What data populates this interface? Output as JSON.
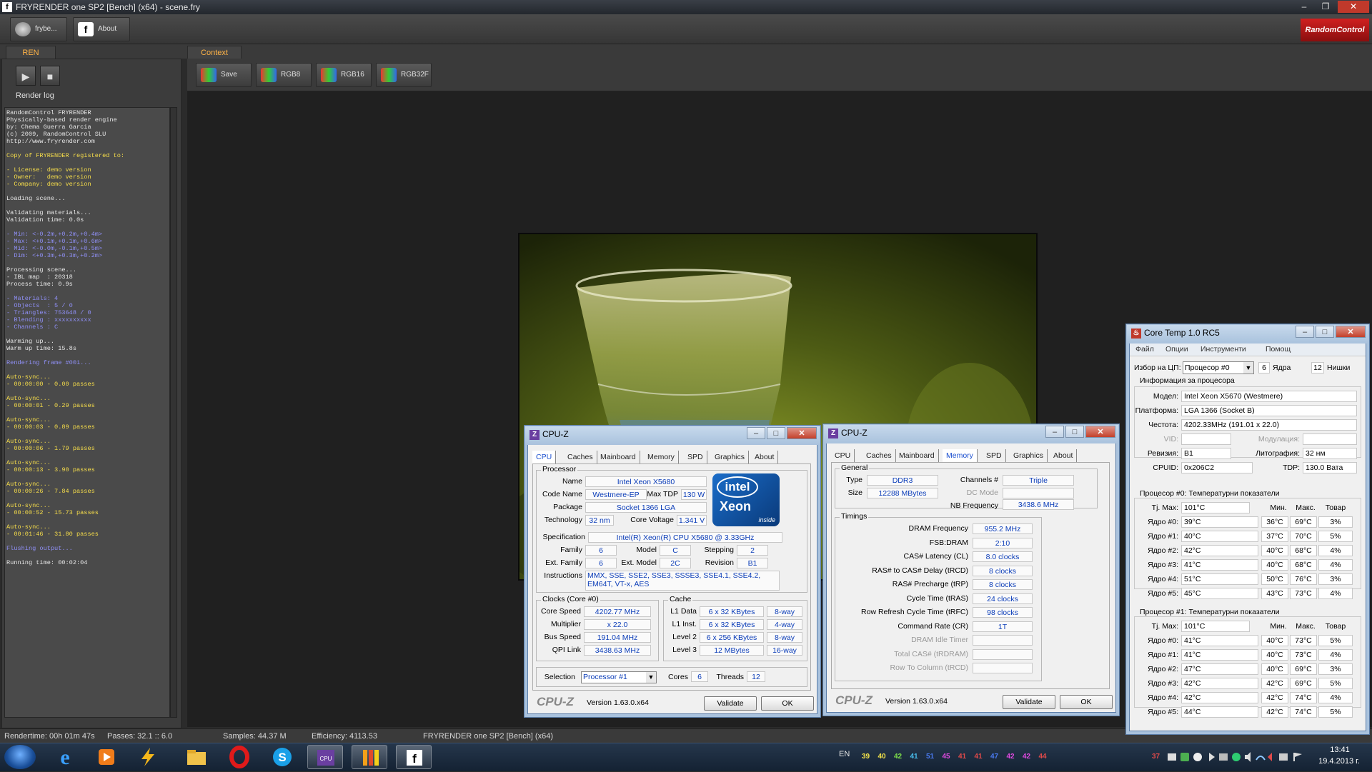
{
  "window": {
    "title": "FRYRENDER one SP2 [Bench] (x64) - scene.fry"
  },
  "toolbar": {
    "fry_label": "frybe...",
    "about_label": "About",
    "brand": "RandomControl"
  },
  "tabs": {
    "ren": "REN",
    "context": "Context"
  },
  "context_toolbar": {
    "save": "Save",
    "rgb8": "RGB8",
    "rgb16": "RGB16",
    "rgb32f": "RGB32F"
  },
  "render_log": {
    "title": "Render log",
    "lines": [
      {
        "t": "RandomControl FRYRENDER",
        "c": "w"
      },
      {
        "t": "Physically-based render engine",
        "c": "w"
      },
      {
        "t": "by: Chema Guerra Garcia",
        "c": "w"
      },
      {
        "t": "(c) 2009, RandomControl SLU",
        "c": "w"
      },
      {
        "t": "http://www.fryrender.com",
        "c": "w"
      },
      {
        "t": "",
        "c": "w"
      },
      {
        "t": "Copy of FRYRENDER registered to:",
        "c": "y"
      },
      {
        "t": "",
        "c": "w"
      },
      {
        "t": "- License: demo version",
        "c": "y"
      },
      {
        "t": "- Owner:   demo version",
        "c": "y"
      },
      {
        "t": "- Company: demo version",
        "c": "y"
      },
      {
        "t": "",
        "c": "w"
      },
      {
        "t": "Loading scene...",
        "c": "w"
      },
      {
        "t": "",
        "c": "w"
      },
      {
        "t": "Validating materials...",
        "c": "w"
      },
      {
        "t": "Validation time: 0.0s",
        "c": "w"
      },
      {
        "t": "",
        "c": "w"
      },
      {
        "t": "- Min: <-0.2m,+0.2m,+0.4m>",
        "c": "b"
      },
      {
        "t": "- Max: <+0.1m,+0.1m,+0.6m>",
        "c": "b"
      },
      {
        "t": "- Mid: <-0.0m,-0.1m,+0.5m>",
        "c": "b"
      },
      {
        "t": "- Dim: <+0.3m,+0.3m,+0.2m>",
        "c": "b"
      },
      {
        "t": "",
        "c": "w"
      },
      {
        "t": "Processing scene...",
        "c": "w"
      },
      {
        "t": "- IBL map  : 20318",
        "c": "w"
      },
      {
        "t": "Process time: 0.9s",
        "c": "w"
      },
      {
        "t": "",
        "c": "w"
      },
      {
        "t": "- Materials: 4",
        "c": "b"
      },
      {
        "t": "- Objects  : 5 / 0",
        "c": "b"
      },
      {
        "t": "- Triangles: 753648 / 0",
        "c": "b"
      },
      {
        "t": "- Blending : xxxxxxxxxx",
        "c": "b"
      },
      {
        "t": "- Channels : C",
        "c": "b"
      },
      {
        "t": "",
        "c": "w"
      },
      {
        "t": "Warming up...",
        "c": "w"
      },
      {
        "t": "Warm up time: 15.8s",
        "c": "w"
      },
      {
        "t": "",
        "c": "w"
      },
      {
        "t": "Rendering frame #001...",
        "c": "b"
      },
      {
        "t": "",
        "c": "w"
      },
      {
        "t": "Auto-sync...",
        "c": "y"
      },
      {
        "t": "- 00:00:00 - 0.00 passes",
        "c": "y"
      },
      {
        "t": "",
        "c": "w"
      },
      {
        "t": "Auto-sync...",
        "c": "y"
      },
      {
        "t": "- 00:00:01 - 0.29 passes",
        "c": "y"
      },
      {
        "t": "",
        "c": "w"
      },
      {
        "t": "Auto-sync...",
        "c": "y"
      },
      {
        "t": "- 00:00:03 - 0.89 passes",
        "c": "y"
      },
      {
        "t": "",
        "c": "w"
      },
      {
        "t": "Auto-sync...",
        "c": "y"
      },
      {
        "t": "- 00:00:06 - 1.79 passes",
        "c": "y"
      },
      {
        "t": "",
        "c": "w"
      },
      {
        "t": "Auto-sync...",
        "c": "y"
      },
      {
        "t": "- 00:00:13 - 3.90 passes",
        "c": "y"
      },
      {
        "t": "",
        "c": "w"
      },
      {
        "t": "Auto-sync...",
        "c": "y"
      },
      {
        "t": "- 00:00:26 - 7.84 passes",
        "c": "y"
      },
      {
        "t": "",
        "c": "w"
      },
      {
        "t": "Auto-sync...",
        "c": "y"
      },
      {
        "t": "- 00:00:52 - 15.73 passes",
        "c": "y"
      },
      {
        "t": "",
        "c": "w"
      },
      {
        "t": "Auto-sync...",
        "c": "y"
      },
      {
        "t": "- 00:01:46 - 31.80 passes",
        "c": "y"
      },
      {
        "t": "",
        "c": "w"
      },
      {
        "t": "Flushing output...",
        "c": "b"
      },
      {
        "t": "",
        "c": "w"
      },
      {
        "t": "Running time: 00:02:04",
        "c": "w"
      }
    ]
  },
  "statusbar": {
    "rendertime": "Rendertime:  00h 01m 47s",
    "passes": "Passes:  32.1 :: 6.0",
    "samples": "Samples:  44.37 M",
    "efficiency": "Efficiency:  4113.53",
    "app": "FRYRENDER one SP2 [Bench] (x64)"
  },
  "cpuz1": {
    "title": "CPU-Z",
    "tabs": [
      "CPU",
      "Caches",
      "Mainboard",
      "Memory",
      "SPD",
      "Graphics",
      "About"
    ],
    "active_tab": "CPU",
    "processor_group": "Processor",
    "labels": {
      "name": "Name",
      "code_name": "Code Name",
      "max_tdp": "Max TDP",
      "package": "Package",
      "technology": "Technology",
      "core_voltage": "Core Voltage",
      "specification": "Specification",
      "family": "Family",
      "model": "Model",
      "stepping": "Stepping",
      "ext_family": "Ext. Family",
      "ext_model": "Ext. Model",
      "revision": "Revision",
      "instructions": "Instructions"
    },
    "values": {
      "name": "Intel Xeon X5680",
      "code_name": "Westmere-EP",
      "max_tdp": "130 W",
      "package": "Socket 1366 LGA",
      "technology": "32 nm",
      "core_voltage": "1.341 V",
      "specification": "Intel(R) Xeon(R) CPU          X5680  @ 3.33GHz",
      "family": "6",
      "model": "C",
      "stepping": "2",
      "ext_family": "6",
      "ext_model": "2C",
      "revision": "B1",
      "instructions": "MMX, SSE, SSE2, SSE3, SSSE3, SSE4.1, SSE4.2, EM64T, VT-x, AES"
    },
    "logo": {
      "brand": "intel",
      "product": "Xeon",
      "tag": "inside"
    },
    "clocks": {
      "group": "Clocks (Core #0)",
      "core_speed_l": "Core Speed",
      "core_speed": "4202.77 MHz",
      "multiplier_l": "Multiplier",
      "multiplier": "x 22.0",
      "bus_speed_l": "Bus Speed",
      "bus_speed": "191.04 MHz",
      "qpi_l": "QPI Link",
      "qpi": "3438.63 MHz"
    },
    "cache": {
      "group": "Cache",
      "l1d_l": "L1 Data",
      "l1d": "6 x 32 KBytes",
      "l1d_w": "8-way",
      "l1i_l": "L1 Inst.",
      "l1i": "6 x 32 KBytes",
      "l1i_w": "4-way",
      "l2_l": "Level 2",
      "l2": "6 x 256 KBytes",
      "l2_w": "8-way",
      "l3_l": "Level 3",
      "l3": "12 MBytes",
      "l3_w": "16-way"
    },
    "selection_l": "Selection",
    "selection": "Processor #1",
    "cores_l": "Cores",
    "cores": "6",
    "threads_l": "Threads",
    "threads": "12",
    "footer": {
      "logo": "CPU-Z",
      "version": "Version 1.63.0.x64",
      "validate": "Validate",
      "ok": "OK"
    }
  },
  "cpuz2": {
    "title": "CPU-Z",
    "tabs": [
      "CPU",
      "Caches",
      "Mainboard",
      "Memory",
      "SPD",
      "Graphics",
      "About"
    ],
    "active_tab": "Memory",
    "general": {
      "group": "General",
      "type_l": "Type",
      "type": "DDR3",
      "channels_l": "Channels #",
      "channels": "Triple",
      "size_l": "Size",
      "size": "12288 MBytes",
      "dcmode_l": "DC Mode",
      "dcmode": "",
      "nbfreq_l": "NB Frequency",
      "nbfreq": "3438.6 MHz"
    },
    "timings": {
      "group": "Timings",
      "rows": [
        {
          "label": "DRAM Frequency",
          "value": "955.2 MHz",
          "dim": false
        },
        {
          "label": "FSB:DRAM",
          "value": "2:10",
          "dim": false
        },
        {
          "label": "CAS# Latency (CL)",
          "value": "8.0 clocks",
          "dim": false
        },
        {
          "label": "RAS# to CAS# Delay (tRCD)",
          "value": "8 clocks",
          "dim": false
        },
        {
          "label": "RAS# Precharge (tRP)",
          "value": "8 clocks",
          "dim": false
        },
        {
          "label": "Cycle Time (tRAS)",
          "value": "24 clocks",
          "dim": false
        },
        {
          "label": "Row Refresh Cycle Time (tRFC)",
          "value": "98 clocks",
          "dim": false
        },
        {
          "label": "Command Rate (CR)",
          "value": "1T",
          "dim": false
        },
        {
          "label": "DRAM Idle Timer",
          "value": "",
          "dim": true
        },
        {
          "label": "Total CAS# (tRDRAM)",
          "value": "",
          "dim": true
        },
        {
          "label": "Row To Column (tRCD)",
          "value": "",
          "dim": true
        }
      ]
    },
    "footer": {
      "logo": "CPU-Z",
      "version": "Version 1.63.0.x64",
      "validate": "Validate",
      "ok": "OK"
    }
  },
  "coretemp": {
    "title": "Core Temp 1.0 RC5",
    "menu": [
      "Файл",
      "Опции",
      "Инструменти",
      "Помощ"
    ],
    "cpu_select_l": "Избор на ЦП:",
    "cpu_select": "Процесор #0",
    "cores_n": "6",
    "cores_l": "Ядра",
    "threads_n": "12",
    "threads_l": "Нишки",
    "info_header": "Информация за процесора",
    "model_l": "Модел:",
    "model": "Intel Xeon X5670 (Westmere)",
    "platform_l": "Платформа:",
    "platform": "LGA 1366 (Socket B)",
    "freq_l": "Честота:",
    "freq": "4202.33MHz (191.01 x 22.0)",
    "vid_l": "VID:",
    "vid": "",
    "mod_l": "Модулация:",
    "mod": "",
    "rev_l": "Ревизия:",
    "rev": "B1",
    "litho_l": "Литография:",
    "litho": "32 нм",
    "cpuid_l": "CPUID:",
    "cpuid": "0x206C2",
    "tdp_l": "TDP:",
    "tdp": "130.0 Вата",
    "cpu0": {
      "header": "Процесор #0: Температурни показатели",
      "tjmax_l": "Tj. Max:",
      "tjmax": "101°C",
      "col_min": "Мин.",
      "col_max": "Макс.",
      "col_load": "Товар",
      "rows": [
        {
          "l": "Ядро #0:",
          "t": "39°C",
          "min": "36°C",
          "max": "69°C",
          "load": "3%"
        },
        {
          "l": "Ядро #1:",
          "t": "40°C",
          "min": "37°C",
          "max": "70°C",
          "load": "5%"
        },
        {
          "l": "Ядро #2:",
          "t": "42°C",
          "min": "40°C",
          "max": "68°C",
          "load": "4%"
        },
        {
          "l": "Ядро #3:",
          "t": "41°C",
          "min": "40°C",
          "max": "68°C",
          "load": "4%"
        },
        {
          "l": "Ядро #4:",
          "t": "51°C",
          "min": "50°C",
          "max": "76°C",
          "load": "3%"
        },
        {
          "l": "Ядро #5:",
          "t": "45°C",
          "min": "43°C",
          "max": "73°C",
          "load": "4%"
        }
      ]
    },
    "cpu1": {
      "header": "Процесор #1: Температурни показатели",
      "tjmax_l": "Tj. Max:",
      "tjmax": "101°C",
      "col_min": "Мин.",
      "col_max": "Макс.",
      "col_load": "Товар",
      "rows": [
        {
          "l": "Ядро #0:",
          "t": "41°C",
          "min": "40°C",
          "max": "73°C",
          "load": "5%"
        },
        {
          "l": "Ядро #1:",
          "t": "41°C",
          "min": "40°C",
          "max": "73°C",
          "load": "4%"
        },
        {
          "l": "Ядро #2:",
          "t": "47°C",
          "min": "40°C",
          "max": "69°C",
          "load": "3%"
        },
        {
          "l": "Ядро #3:",
          "t": "42°C",
          "min": "42°C",
          "max": "69°C",
          "load": "5%"
        },
        {
          "l": "Ядро #4:",
          "t": "42°C",
          "min": "42°C",
          "max": "74°C",
          "load": "4%"
        },
        {
          "l": "Ядро #5:",
          "t": "44°C",
          "min": "42°C",
          "max": "74°C",
          "load": "5%"
        }
      ]
    }
  },
  "taskbar": {
    "lang": "EN",
    "tray_temps": [
      {
        "v": "39",
        "color": "#f2e24a"
      },
      {
        "v": "40",
        "color": "#f2e24a"
      },
      {
        "v": "42",
        "color": "#7ee04a"
      },
      {
        "v": "41",
        "color": "#4ac0f0"
      },
      {
        "v": "51",
        "color": "#4a7af0"
      },
      {
        "v": "45",
        "color": "#e04ae0"
      },
      {
        "v": "41",
        "color": "#e04a4a"
      },
      {
        "v": "41",
        "color": "#e04a4a"
      },
      {
        "v": "47",
        "color": "#4a7af0"
      },
      {
        "v": "42",
        "color": "#e04ae0"
      },
      {
        "v": "42",
        "color": "#e04ae0"
      },
      {
        "v": "44",
        "color": "#e04a4a"
      }
    ],
    "tray_extra": "37",
    "time": "13:41",
    "date": "19.4.2013 г."
  }
}
